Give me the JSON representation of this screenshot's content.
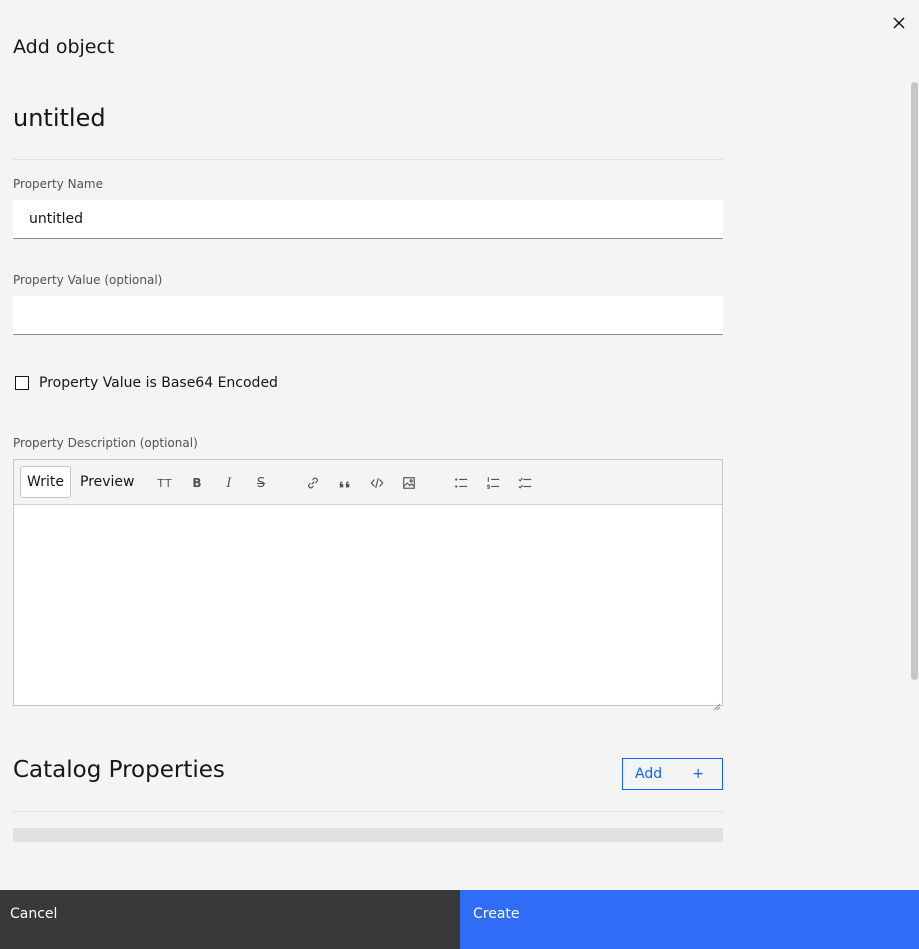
{
  "header": {
    "title": "Add object",
    "close_icon": "close-icon"
  },
  "object": {
    "title": "untitled"
  },
  "fields": {
    "name": {
      "label": "Property Name",
      "value": "untitled",
      "placeholder": ""
    },
    "value": {
      "label": "Property Value (optional)",
      "value": "",
      "placeholder": ""
    },
    "base64": {
      "label": "Property Value is Base64 Encoded",
      "checked": false
    },
    "description": {
      "label": "Property Description (optional)"
    }
  },
  "editor": {
    "tabs": {
      "write": "Write",
      "preview": "Preview"
    },
    "tools": {
      "heading": "TT",
      "bold": "B",
      "italic": "I",
      "strikethrough": "S",
      "link": "link-icon",
      "quote": "quote-icon",
      "code": "code-icon",
      "image": "image-icon",
      "bulleted_list": "bulleted-list-icon",
      "numbered_list": "numbered-list-icon",
      "task_list": "task-list-icon"
    },
    "content": ""
  },
  "catalog": {
    "title": "Catalog Properties",
    "add_label": "Add",
    "add_icon": "+"
  },
  "footer": {
    "cancel_label": "Cancel",
    "create_label": "Create"
  },
  "colors": {
    "primary": "#0f62fe",
    "create_bg": "#2f6df6",
    "cancel_bg": "#393939",
    "background": "#f4f4f4"
  }
}
